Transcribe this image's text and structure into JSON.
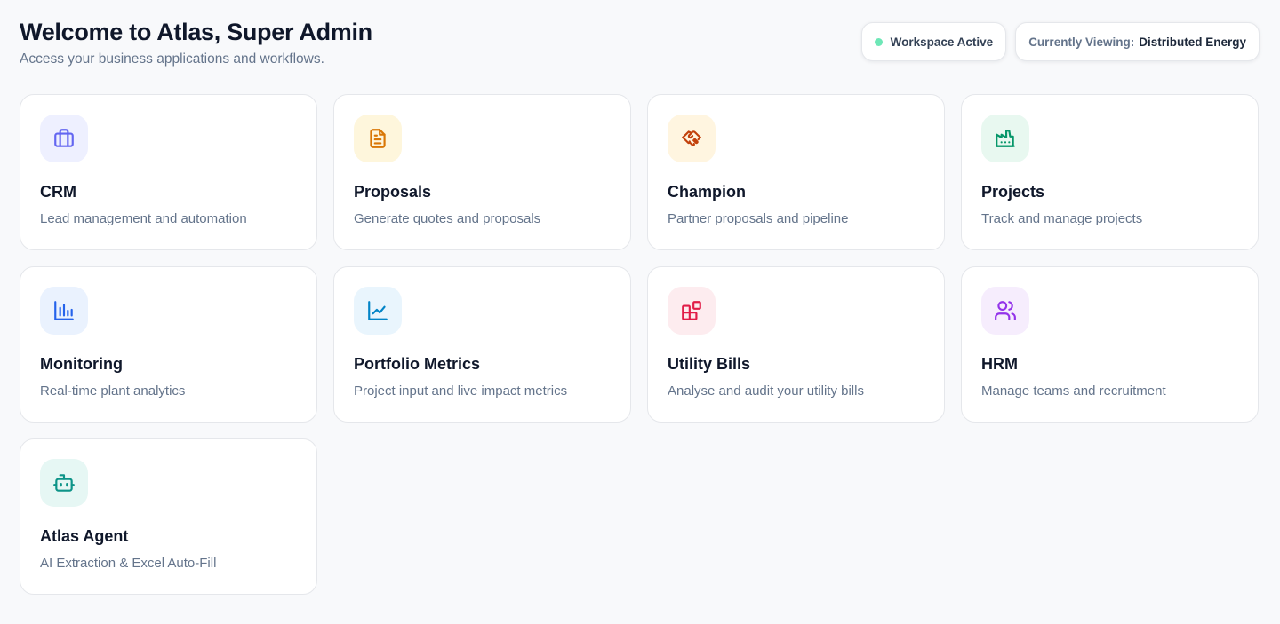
{
  "header": {
    "title": "Welcome to Atlas, Super Admin",
    "subtitle": "Access your business applications and workflows."
  },
  "badges": {
    "workspace_status": "Workspace Active",
    "currently_viewing_label": "Currently Viewing:",
    "currently_viewing_value": "Distributed Energy"
  },
  "apps": [
    {
      "title": "CRM",
      "description": "Lead management and automation",
      "icon": "briefcase-icon",
      "color": "#6366f1",
      "bg": "#eef0ff"
    },
    {
      "title": "Proposals",
      "description": "Generate quotes and proposals",
      "icon": "document-icon",
      "color": "#d97706",
      "bg": "#fef6dc"
    },
    {
      "title": "Champion",
      "description": "Partner proposals and pipeline",
      "icon": "handshake-icon",
      "color": "#c2410c",
      "bg": "#fff5e0"
    },
    {
      "title": "Projects",
      "description": "Track and manage projects",
      "icon": "factory-icon",
      "color": "#059669",
      "bg": "#e8f8f0"
    },
    {
      "title": "Monitoring",
      "description": "Real-time plant analytics",
      "icon": "bar-chart-icon",
      "color": "#2563eb",
      "bg": "#eaf2fe"
    },
    {
      "title": "Portfolio Metrics",
      "description": "Project input and live impact metrics",
      "icon": "line-chart-icon",
      "color": "#0284c7",
      "bg": "#e9f5fd"
    },
    {
      "title": "Utility Bills",
      "description": "Analyse and audit your utility bills",
      "icon": "blocks-icon",
      "color": "#e11d48",
      "bg": "#fdecef"
    },
    {
      "title": "HRM",
      "description": "Manage teams and recruitment",
      "icon": "users-icon",
      "color": "#9333ea",
      "bg": "#f6edfd"
    },
    {
      "title": "Atlas Agent",
      "description": "AI Extraction & Excel Auto-Fill",
      "icon": "bot-icon",
      "color": "#0d9488",
      "bg": "#e6f7f4"
    }
  ],
  "colors": {
    "status_dot": "#6ee7b7",
    "background": "#f8f9fb"
  }
}
